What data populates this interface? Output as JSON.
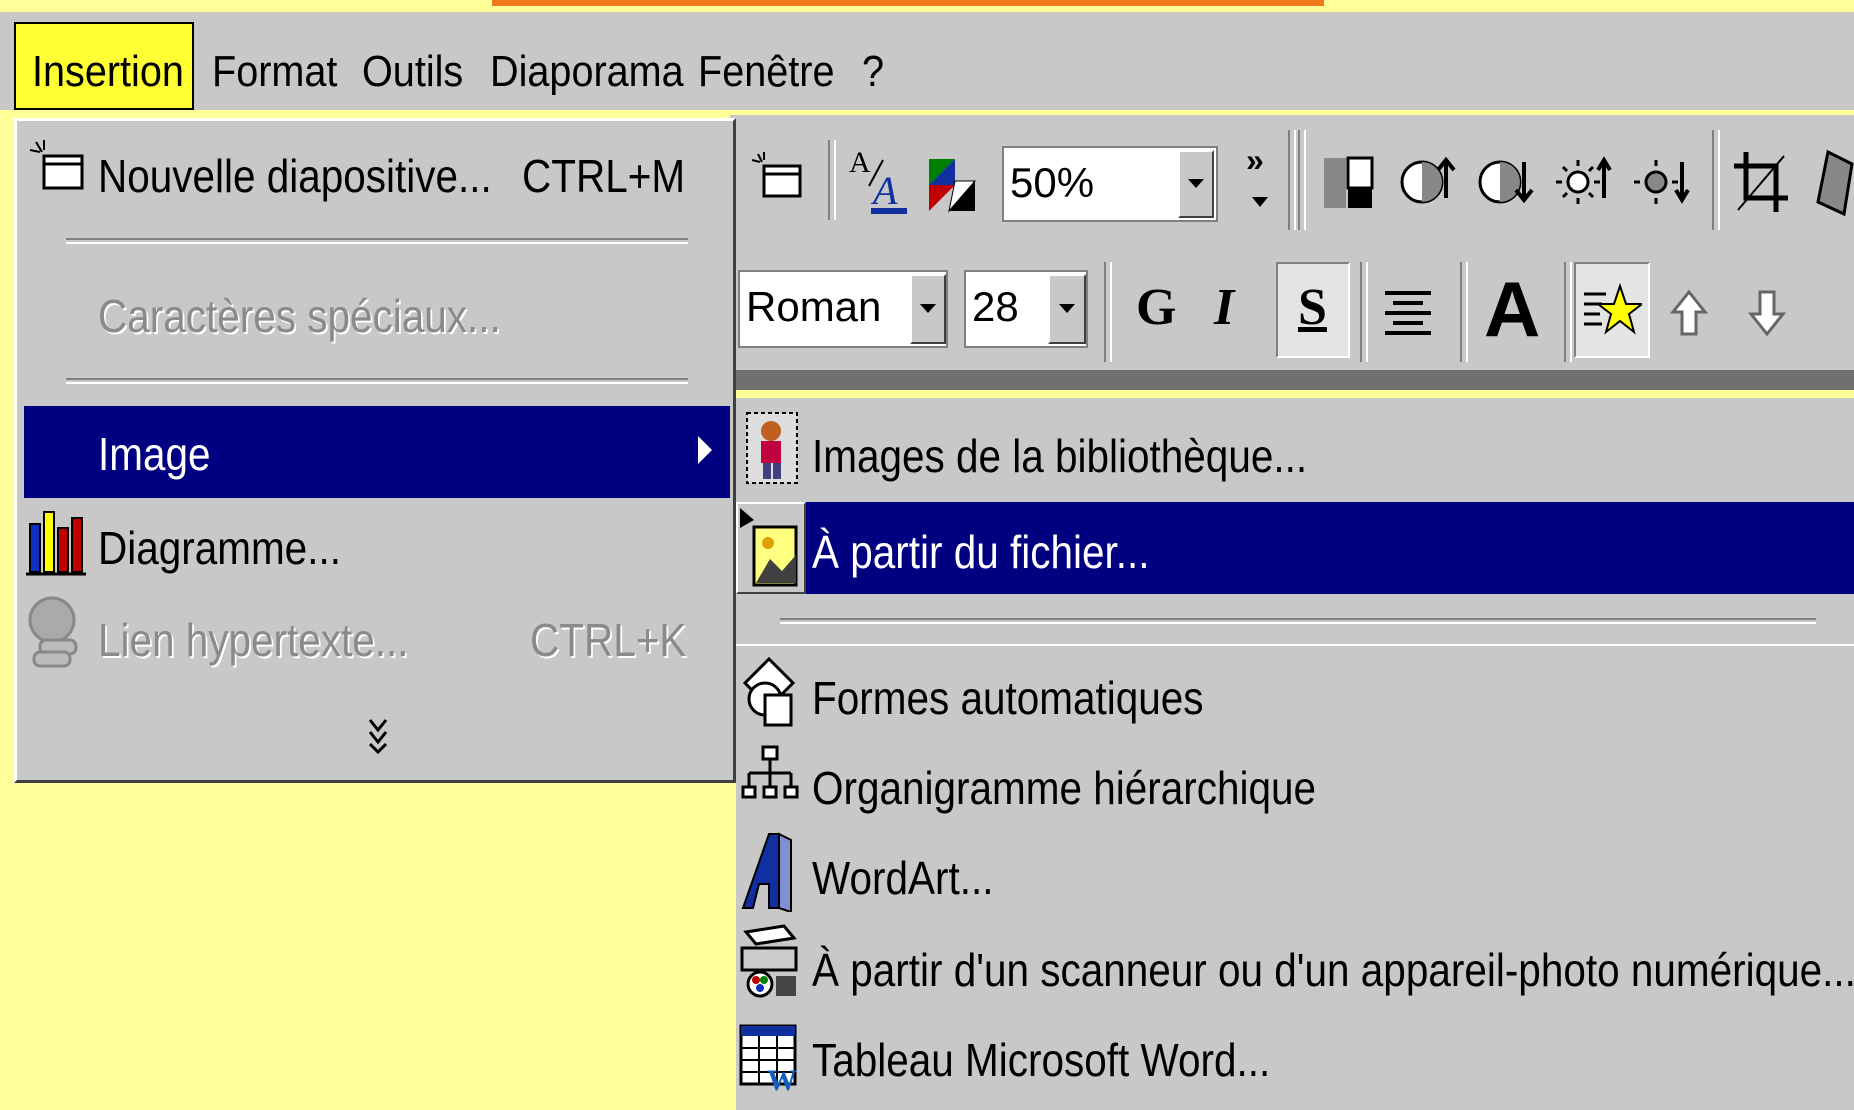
{
  "menubar": {
    "items": [
      "Insertion",
      "Format",
      "Outils",
      "Diaporama",
      "Fenêtre",
      "?"
    ]
  },
  "toolbar": {
    "zoom": "50%",
    "font": "Roman",
    "size": "28",
    "bold": "G",
    "italic": "I",
    "shadow": "S",
    "grow": "A",
    "more": "»"
  },
  "insert_menu": {
    "new_slide": "Nouvelle diapositive...",
    "new_slide_shortcut": "CTRL+M",
    "special_chars": "Caractères spéciaux...",
    "image": "Image",
    "chart": "Diagramme...",
    "hyperlink": "Lien hypertexte...",
    "hyperlink_shortcut": "CTRL+K",
    "expand": "⌄"
  },
  "image_submenu": {
    "clipart": "Images de la bibliothèque...",
    "from_file": "À partir du fichier...",
    "autoshapes": "Formes automatiques",
    "org_chart": "Organigramme hiérarchique",
    "wordart": "WordArt...",
    "scanner": "À partir d'un scanneur ou d'un appareil-photo numérique...",
    "word_table": "Tableau Microsoft Word..."
  },
  "colors": {
    "background": "#ffff99",
    "highlight": "#000080",
    "menu": "#c8c8c8",
    "active_menu": "#ffff33"
  }
}
